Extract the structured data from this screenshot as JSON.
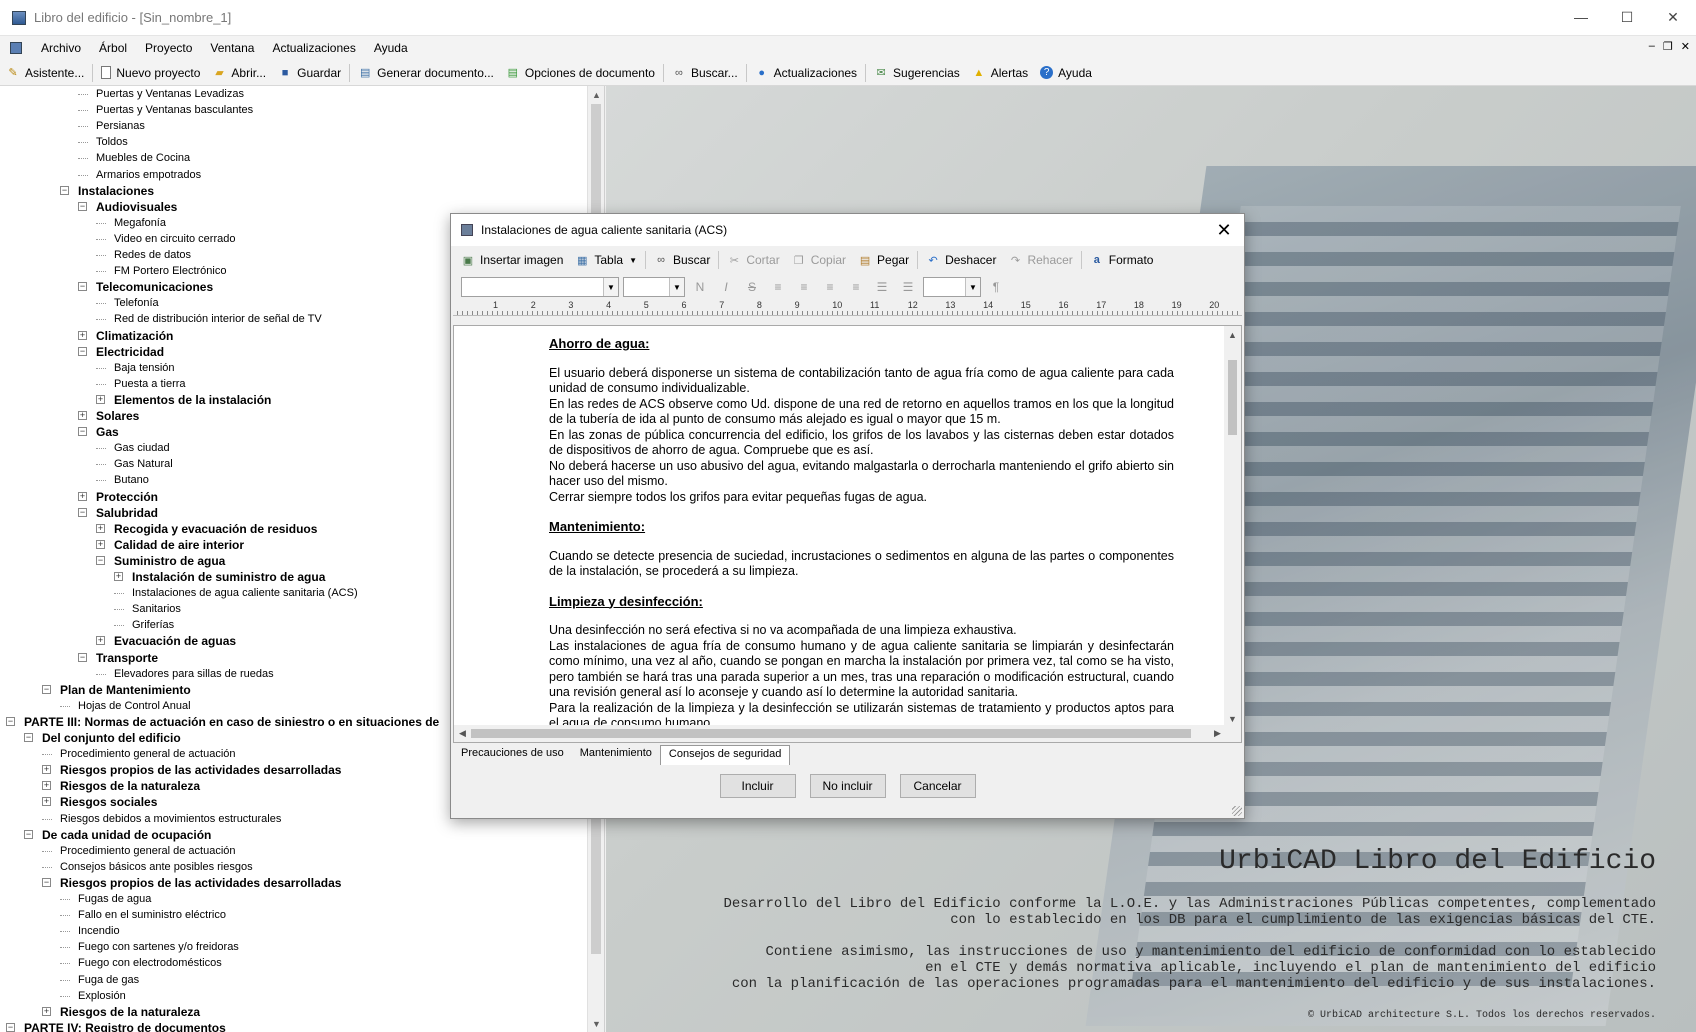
{
  "window": {
    "title": "Libro del edificio - [Sin_nombre_1]",
    "controls": [
      "—",
      "☐",
      "✕"
    ]
  },
  "menu": [
    "Archivo",
    "Árbol",
    "Proyecto",
    "Ventana",
    "Actualizaciones",
    "Ayuda"
  ],
  "mdi_controls": [
    "‒",
    "❐",
    "✕"
  ],
  "toolbar": {
    "items": [
      {
        "label": "Asistente...",
        "icon": "wand-icon"
      },
      {
        "label": "Nuevo proyecto",
        "icon": "new-document-icon"
      },
      {
        "label": "Abrir...",
        "icon": "open-folder-icon"
      },
      {
        "label": "Guardar",
        "icon": "save-icon"
      },
      {
        "label": "Generar documento...",
        "icon": "generate-document-icon"
      },
      {
        "label": "Opciones de documento",
        "icon": "document-options-icon"
      },
      {
        "label": "Buscar...",
        "icon": "binoculars-icon"
      },
      {
        "label": "Actualizaciones",
        "icon": "updates-icon"
      },
      {
        "label": "Sugerencias",
        "icon": "suggestions-icon"
      },
      {
        "label": "Alertas",
        "icon": "warning-icon"
      },
      {
        "label": "Ayuda",
        "icon": "help-icon"
      }
    ]
  },
  "tree": [
    {
      "t": "Puertas y Ventanas Levadizas",
      "d": 6,
      "b": false,
      "e": ""
    },
    {
      "t": "Puertas y Ventanas basculantes",
      "d": 6,
      "b": false,
      "e": ""
    },
    {
      "t": "Persianas",
      "d": 6,
      "b": false,
      "e": ""
    },
    {
      "t": "Toldos",
      "d": 6,
      "b": false,
      "e": ""
    },
    {
      "t": "Muebles de Cocina",
      "d": 6,
      "b": false,
      "e": ""
    },
    {
      "t": "Armarios empotrados",
      "d": 6,
      "b": false,
      "e": ""
    },
    {
      "t": "Instalaciones",
      "d": 5,
      "b": true,
      "e": "-"
    },
    {
      "t": "Audiovisuales",
      "d": 6,
      "b": true,
      "e": "-"
    },
    {
      "t": "Megafonía",
      "d": 7,
      "b": false,
      "e": ""
    },
    {
      "t": "Video en circuito cerrado",
      "d": 7,
      "b": false,
      "e": ""
    },
    {
      "t": "Redes de datos",
      "d": 7,
      "b": false,
      "e": ""
    },
    {
      "t": "FM   Portero Electrónico",
      "d": 7,
      "b": false,
      "e": ""
    },
    {
      "t": "Telecomunicaciones",
      "d": 6,
      "b": true,
      "e": "-"
    },
    {
      "t": "Telefonía",
      "d": 7,
      "b": false,
      "e": ""
    },
    {
      "t": "Red de distribución interior de señal de TV",
      "d": 7,
      "b": false,
      "e": ""
    },
    {
      "t": "Climatización",
      "d": 6,
      "b": true,
      "e": "+"
    },
    {
      "t": "Electricidad",
      "d": 6,
      "b": true,
      "e": "-"
    },
    {
      "t": "Baja tensión",
      "d": 7,
      "b": false,
      "e": ""
    },
    {
      "t": "Puesta a tierra",
      "d": 7,
      "b": false,
      "e": ""
    },
    {
      "t": "Elementos de la instalación",
      "d": 7,
      "b": true,
      "e": "+"
    },
    {
      "t": "Solares",
      "d": 6,
      "b": true,
      "e": "+"
    },
    {
      "t": "Gas",
      "d": 6,
      "b": true,
      "e": "-"
    },
    {
      "t": "Gas ciudad",
      "d": 7,
      "b": false,
      "e": ""
    },
    {
      "t": "Gas Natural",
      "d": 7,
      "b": false,
      "e": ""
    },
    {
      "t": "Butano",
      "d": 7,
      "b": false,
      "e": ""
    },
    {
      "t": "Protección",
      "d": 6,
      "b": true,
      "e": "+"
    },
    {
      "t": "Salubridad",
      "d": 6,
      "b": true,
      "e": "-"
    },
    {
      "t": "Recogida y evacuación de residuos",
      "d": 7,
      "b": true,
      "e": "+"
    },
    {
      "t": "Calidad de aire interior",
      "d": 7,
      "b": true,
      "e": "+"
    },
    {
      "t": "Suministro de agua",
      "d": 7,
      "b": true,
      "e": "-"
    },
    {
      "t": "Instalación de suministro de agua",
      "d": 8,
      "b": true,
      "e": "+"
    },
    {
      "t": "Instalaciones de agua caliente sanitaria (ACS)",
      "d": 8,
      "b": false,
      "e": ""
    },
    {
      "t": "Sanitarios",
      "d": 8,
      "b": false,
      "e": ""
    },
    {
      "t": "Griferías",
      "d": 8,
      "b": false,
      "e": ""
    },
    {
      "t": "Evacuación de aguas",
      "d": 7,
      "b": true,
      "e": "+"
    },
    {
      "t": "Transporte",
      "d": 6,
      "b": true,
      "e": "-"
    },
    {
      "t": "Elevadores para sillas de ruedas",
      "d": 7,
      "b": false,
      "e": ""
    },
    {
      "t": "Plan de Mantenimiento",
      "d": 4,
      "b": true,
      "e": "-"
    },
    {
      "t": "Hojas de Control Anual",
      "d": 5,
      "b": false,
      "e": ""
    },
    {
      "t": "PARTE III: Normas de actuación en caso de siniestro o en situaciones de",
      "d": 2,
      "b": true,
      "e": "-"
    },
    {
      "t": "Del conjunto del edificio",
      "d": 3,
      "b": true,
      "e": "-"
    },
    {
      "t": "Procedimiento general de actuación",
      "d": 4,
      "b": false,
      "e": ""
    },
    {
      "t": "Riesgos propios de las actividades desarrolladas",
      "d": 4,
      "b": true,
      "e": "+"
    },
    {
      "t": "Riesgos de la naturaleza",
      "d": 4,
      "b": true,
      "e": "+"
    },
    {
      "t": "Riesgos sociales",
      "d": 4,
      "b": true,
      "e": "+"
    },
    {
      "t": "Riesgos debidos a movimientos estructurales",
      "d": 4,
      "b": false,
      "e": ""
    },
    {
      "t": "De cada unidad de ocupación",
      "d": 3,
      "b": true,
      "e": "-"
    },
    {
      "t": "Procedimiento general de actuación",
      "d": 4,
      "b": false,
      "e": ""
    },
    {
      "t": "Consejos básicos ante  posibles riesgos",
      "d": 4,
      "b": false,
      "e": ""
    },
    {
      "t": "Riesgos propios de las actividades desarrolladas",
      "d": 4,
      "b": true,
      "e": "-"
    },
    {
      "t": "Fugas de agua",
      "d": 5,
      "b": false,
      "e": ""
    },
    {
      "t": "Fallo en el suministro eléctrico",
      "d": 5,
      "b": false,
      "e": ""
    },
    {
      "t": "Incendio",
      "d": 5,
      "b": false,
      "e": ""
    },
    {
      "t": "Fuego con sartenes y/o freidoras",
      "d": 5,
      "b": false,
      "e": ""
    },
    {
      "t": "Fuego con electrodomésticos",
      "d": 5,
      "b": false,
      "e": ""
    },
    {
      "t": "Fuga de gas",
      "d": 5,
      "b": false,
      "e": ""
    },
    {
      "t": "Explosión",
      "d": 5,
      "b": false,
      "e": ""
    },
    {
      "t": "Riesgos de la naturaleza",
      "d": 4,
      "b": true,
      "e": "+"
    },
    {
      "t": "PARTE IV: Registro de documentos",
      "d": 2,
      "b": true,
      "e": "-"
    }
  ],
  "dialog": {
    "title": "Instalaciones de agua caliente sanitaria (ACS)",
    "toolbar": [
      {
        "label": "Insertar imagen",
        "icon": "insert-image-icon",
        "enabled": true
      },
      {
        "label": "Tabla",
        "icon": "table-icon",
        "enabled": true,
        "dropdown": true
      },
      {
        "label": "Buscar",
        "icon": "binoculars-icon",
        "enabled": true
      },
      {
        "label": "Cortar",
        "icon": "cut-icon",
        "enabled": false
      },
      {
        "label": "Copiar",
        "icon": "copy-icon",
        "enabled": false
      },
      {
        "label": "Pegar",
        "icon": "paste-icon",
        "enabled": true
      },
      {
        "label": "Deshacer",
        "icon": "undo-icon",
        "enabled": true
      },
      {
        "label": "Rehacer",
        "icon": "redo-icon",
        "enabled": false
      },
      {
        "label": "Formato",
        "icon": "format-icon",
        "enabled": true
      }
    ],
    "format_icons": [
      "N",
      "I",
      "S",
      "≡",
      "≡",
      "≡",
      "≡",
      "☰",
      "☰",
      "¶"
    ],
    "ruler_marks": [
      "1",
      "2",
      "3",
      "4",
      "5",
      "6",
      "7",
      "8",
      "9",
      "10",
      "11",
      "12",
      "13",
      "14",
      "15",
      "16",
      "17",
      "18",
      "19",
      "20"
    ],
    "document": [
      {
        "heading": "Ahorro de agua:"
      },
      {
        "p": "El usuario deberá disponerse un sistema de contabilización tanto de agua fría como de agua caliente para cada unidad de consumo individualizable."
      },
      {
        "p": "En las redes de ACS observe como Ud. dispone de una red de retorno en aquellos tramos en los que la longitud de la tubería de ida al punto de consumo más alejado es igual o mayor que 15 m."
      },
      {
        "p": "En las zonas de pública concurrencia del edificio, los grifos de los lavabos y las cisternas deben estar dotados de dispositivos de ahorro de agua. Compruebe que es así."
      },
      {
        "p": "No deberá hacerse un uso abusivo del agua, evitando malgastarla o derrocharla manteniendo el grifo abierto sin hacer uso del mismo."
      },
      {
        "p": "Cerrar siempre todos los grifos para evitar pequeñas fugas de agua."
      },
      {
        "heading": "Mantenimiento:"
      },
      {
        "p": "Cuando se detecte presencia de suciedad, incrustaciones o sedimentos en alguna de las partes o componentes de la instalación, se procederá a su limpieza."
      },
      {
        "heading": "Limpieza y desinfección:"
      },
      {
        "p": "Una desinfección no será efectiva si no va acompañada de una limpieza exhaustiva."
      },
      {
        "p": "Las instalaciones de agua fría de consumo humano y de agua caliente sanitaria se limpiarán y desinfectarán como mínimo, una vez al año, cuando se pongan en marcha la instalación por primera vez, tal como se ha visto, pero también se hará tras una parada superior a un mes, tras una reparación o modificación estructural, cuando una revisión general así lo aconseje y cuando así lo determine la autoridad sanitaria."
      },
      {
        "p": "Para la realización de la limpieza y la desinfección se utilizarán sistemas de tratamiento y productos aptos para el agua de consumo humano."
      }
    ],
    "tabs": [
      {
        "label": "Precauciones de uso",
        "active": false
      },
      {
        "label": "Mantenimiento",
        "active": false
      },
      {
        "label": "Consejos de seguridad",
        "active": true
      }
    ],
    "buttons": {
      "include": "Incluir",
      "exclude": "No incluir",
      "cancel": "Cancelar"
    }
  },
  "branding": {
    "title": "UrbiCAD Libro del Edificio",
    "desc1_l1": "Desarrollo del Libro del Edificio conforme la L.O.E. y las Administraciones Públicas competentes, complementado",
    "desc1_l2": "con lo establecido en los DB para el cumplimiento de las exigencias básicas del CTE.",
    "desc2_l1": "Contiene asimismo, las instrucciones de uso y mantenimiento del edificio de conformidad con lo establecido",
    "desc2_l2": "en el CTE y demás normativa aplicable, incluyendo el plan de mantenimiento del edificio",
    "desc2_l3": "con la planificación de las operaciones programadas para el mantenimiento del edificio y de sus instalaciones.",
    "copyright": "© UrbiCAD architecture S.L.  Todos los derechos reservados."
  }
}
